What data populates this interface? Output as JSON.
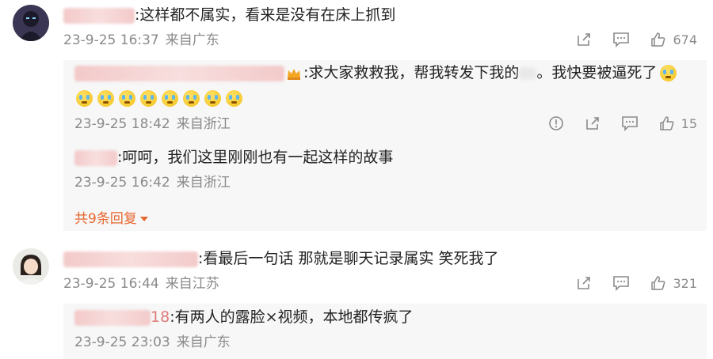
{
  "comments": [
    {
      "text": ":这样都不属实，看来是没有在床上抓到",
      "date": "23-9-25 16:37",
      "location": "来自广东",
      "likes": "674"
    },
    {
      "text": ":看最后一句话 那就是聊天记录属实 笑死我了",
      "date": "23-9-25 16:44",
      "location": "来自江苏",
      "likes": "321"
    }
  ],
  "replies": [
    {
      "text_a": ":求大家救救我，帮我转发下我的",
      "text_b": "。我快要被逼死了",
      "date": "23-9-25 18:42",
      "location": "来自浙江",
      "likes": "15",
      "emoji_count": 8
    },
    {
      "text": ":呵呵，我们这里刚刚也有一起这样的故事",
      "date": "23-9-25 16:42",
      "location": "来自浙江"
    },
    {
      "name_tail": "18",
      "text": ":有两人的露脸×视频，本地都传疯了",
      "date": "23-9-25 23:03",
      "location": "来自广东"
    }
  ],
  "more_replies_label": "共9条回复",
  "icons": {
    "share": "share-icon",
    "comment": "comment-icon",
    "like": "like-icon",
    "report": "report-icon",
    "crown": "crown-icon"
  },
  "colors": {
    "accent": "#e8662f",
    "meta": "#8a8a8a",
    "reply_bg": "#f7f7f7"
  }
}
